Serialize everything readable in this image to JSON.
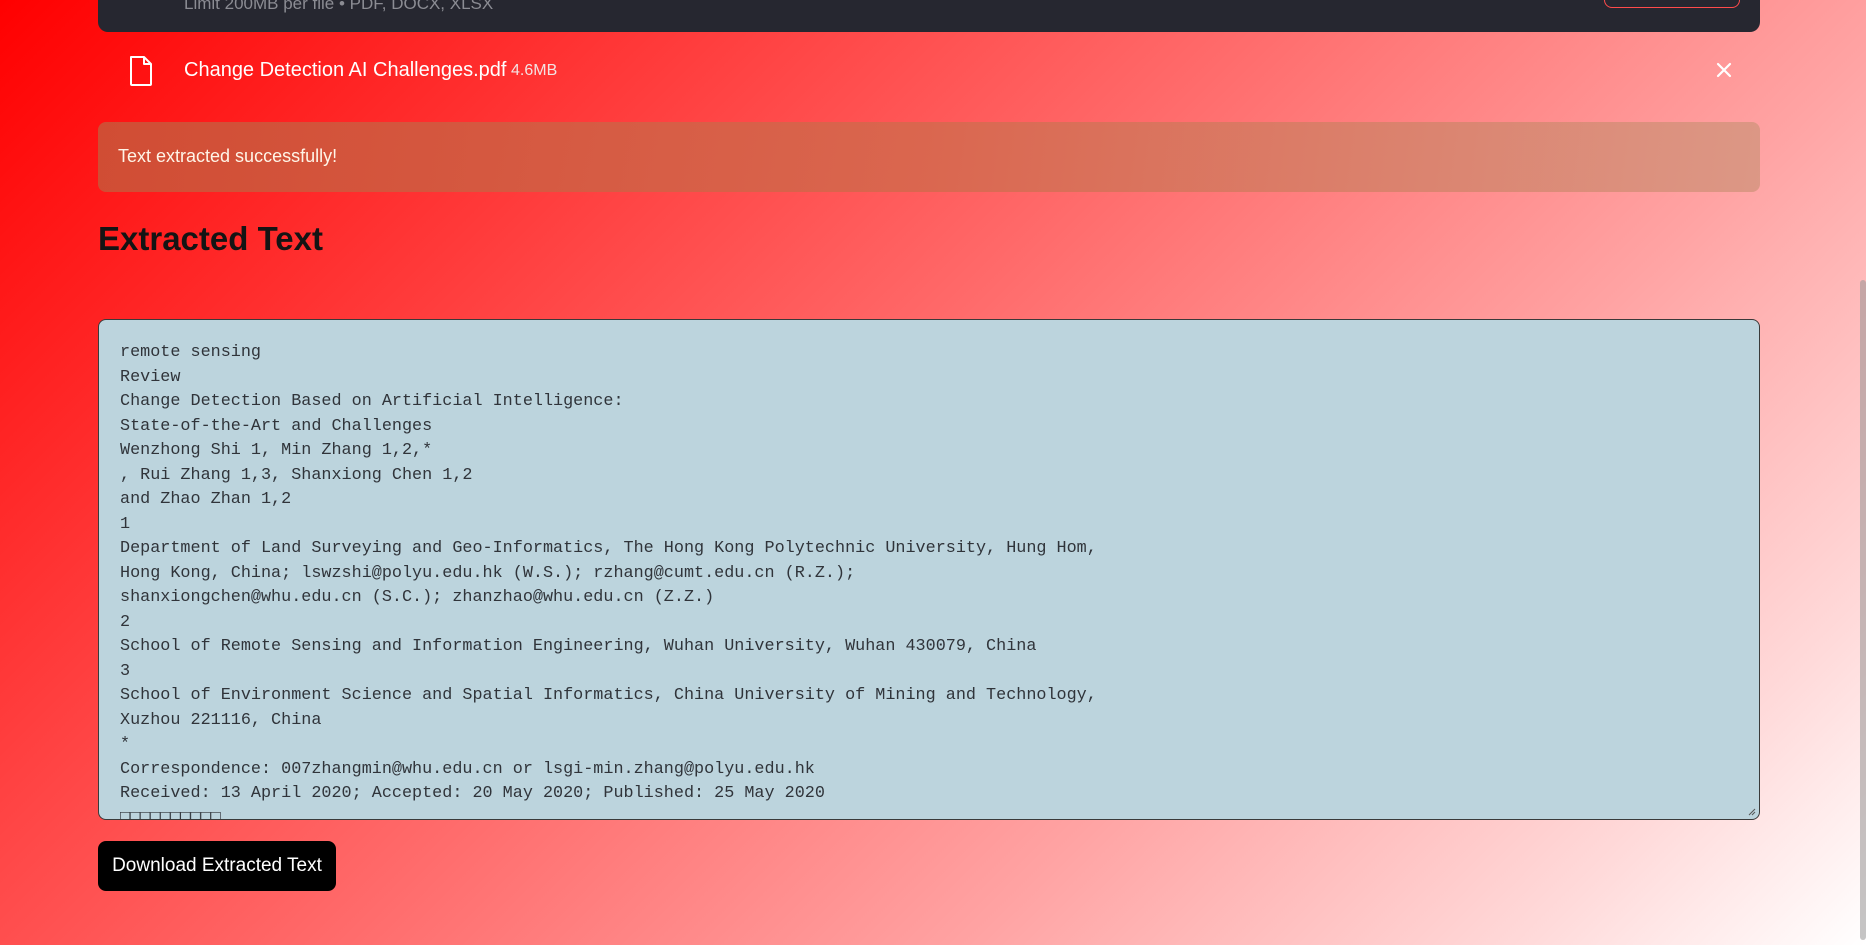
{
  "uploader": {
    "note": "Limit 200MB per file • PDF, DOCX, XLSX"
  },
  "file": {
    "name": "Change Detection AI Challenges.pdf",
    "size": "4.6MB",
    "icon": "file-icon",
    "remove_icon": "close-icon"
  },
  "alert": {
    "message": "Text extracted successfully!"
  },
  "section": {
    "title": "Extracted Text"
  },
  "extracted_text": {
    "lines": [
      "remote sensing",
      "Review",
      "Change Detection Based on Artificial Intelligence:",
      "State-of-the-Art and Challenges",
      "Wenzhong Shi 1, Min Zhang 1,2,*",
      ", Rui Zhang 1,3, Shanxiong Chen 1,2",
      "and Zhao Zhan 1,2",
      "1",
      "Department of Land Surveying and Geo-Informatics, The Hong Kong Polytechnic University, Hung Hom,",
      "Hong Kong, China; lswzshi@polyu.edu.hk (W.S.); rzhang@cumt.edu.cn (R.Z.);",
      "shanxiongchen@whu.edu.cn (S.C.); zhanzhao@whu.edu.cn (Z.Z.)",
      "2",
      "School of Remote Sensing and Information Engineering, Wuhan University, Wuhan 430079, China",
      "3",
      "School of Environment Science and Spatial Informatics, China University of Mining and Technology,",
      "Xuzhou 221116, China",
      "*",
      "Correspondence: 007zhangmin@whu.edu.cn or lsgi-min.zhang@polyu.edu.hk",
      "Received: 13 April 2020; Accepted: 20 May 2020; Published: 25 May 2020",
      "□□□□□□□□□□"
    ]
  },
  "actions": {
    "download_label": "Download Extracted Text"
  },
  "colors": {
    "accent": "#ff4b4b",
    "text_area_bg": "#bcd4dd",
    "button_bg": "#000000"
  }
}
